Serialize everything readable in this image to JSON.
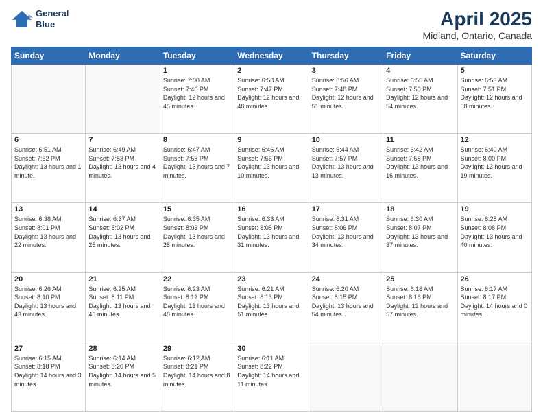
{
  "logo": {
    "line1": "General",
    "line2": "Blue"
  },
  "title": "April 2025",
  "subtitle": "Midland, Ontario, Canada",
  "header_days": [
    "Sunday",
    "Monday",
    "Tuesday",
    "Wednesday",
    "Thursday",
    "Friday",
    "Saturday"
  ],
  "weeks": [
    [
      {
        "num": "",
        "sunrise": "",
        "sunset": "",
        "daylight": "",
        "empty": true
      },
      {
        "num": "",
        "sunrise": "",
        "sunset": "",
        "daylight": "",
        "empty": true
      },
      {
        "num": "1",
        "sunrise": "Sunrise: 7:00 AM",
        "sunset": "Sunset: 7:46 PM",
        "daylight": "Daylight: 12 hours and 45 minutes."
      },
      {
        "num": "2",
        "sunrise": "Sunrise: 6:58 AM",
        "sunset": "Sunset: 7:47 PM",
        "daylight": "Daylight: 12 hours and 48 minutes."
      },
      {
        "num": "3",
        "sunrise": "Sunrise: 6:56 AM",
        "sunset": "Sunset: 7:48 PM",
        "daylight": "Daylight: 12 hours and 51 minutes."
      },
      {
        "num": "4",
        "sunrise": "Sunrise: 6:55 AM",
        "sunset": "Sunset: 7:50 PM",
        "daylight": "Daylight: 12 hours and 54 minutes."
      },
      {
        "num": "5",
        "sunrise": "Sunrise: 6:53 AM",
        "sunset": "Sunset: 7:51 PM",
        "daylight": "Daylight: 12 hours and 58 minutes."
      }
    ],
    [
      {
        "num": "6",
        "sunrise": "Sunrise: 6:51 AM",
        "sunset": "Sunset: 7:52 PM",
        "daylight": "Daylight: 13 hours and 1 minute."
      },
      {
        "num": "7",
        "sunrise": "Sunrise: 6:49 AM",
        "sunset": "Sunset: 7:53 PM",
        "daylight": "Daylight: 13 hours and 4 minutes."
      },
      {
        "num": "8",
        "sunrise": "Sunrise: 6:47 AM",
        "sunset": "Sunset: 7:55 PM",
        "daylight": "Daylight: 13 hours and 7 minutes."
      },
      {
        "num": "9",
        "sunrise": "Sunrise: 6:46 AM",
        "sunset": "Sunset: 7:56 PM",
        "daylight": "Daylight: 13 hours and 10 minutes."
      },
      {
        "num": "10",
        "sunrise": "Sunrise: 6:44 AM",
        "sunset": "Sunset: 7:57 PM",
        "daylight": "Daylight: 13 hours and 13 minutes."
      },
      {
        "num": "11",
        "sunrise": "Sunrise: 6:42 AM",
        "sunset": "Sunset: 7:58 PM",
        "daylight": "Daylight: 13 hours and 16 minutes."
      },
      {
        "num": "12",
        "sunrise": "Sunrise: 6:40 AM",
        "sunset": "Sunset: 8:00 PM",
        "daylight": "Daylight: 13 hours and 19 minutes."
      }
    ],
    [
      {
        "num": "13",
        "sunrise": "Sunrise: 6:38 AM",
        "sunset": "Sunset: 8:01 PM",
        "daylight": "Daylight: 13 hours and 22 minutes."
      },
      {
        "num": "14",
        "sunrise": "Sunrise: 6:37 AM",
        "sunset": "Sunset: 8:02 PM",
        "daylight": "Daylight: 13 hours and 25 minutes."
      },
      {
        "num": "15",
        "sunrise": "Sunrise: 6:35 AM",
        "sunset": "Sunset: 8:03 PM",
        "daylight": "Daylight: 13 hours and 28 minutes."
      },
      {
        "num": "16",
        "sunrise": "Sunrise: 6:33 AM",
        "sunset": "Sunset: 8:05 PM",
        "daylight": "Daylight: 13 hours and 31 minutes."
      },
      {
        "num": "17",
        "sunrise": "Sunrise: 6:31 AM",
        "sunset": "Sunset: 8:06 PM",
        "daylight": "Daylight: 13 hours and 34 minutes."
      },
      {
        "num": "18",
        "sunrise": "Sunrise: 6:30 AM",
        "sunset": "Sunset: 8:07 PM",
        "daylight": "Daylight: 13 hours and 37 minutes."
      },
      {
        "num": "19",
        "sunrise": "Sunrise: 6:28 AM",
        "sunset": "Sunset: 8:08 PM",
        "daylight": "Daylight: 13 hours and 40 minutes."
      }
    ],
    [
      {
        "num": "20",
        "sunrise": "Sunrise: 6:26 AM",
        "sunset": "Sunset: 8:10 PM",
        "daylight": "Daylight: 13 hours and 43 minutes."
      },
      {
        "num": "21",
        "sunrise": "Sunrise: 6:25 AM",
        "sunset": "Sunset: 8:11 PM",
        "daylight": "Daylight: 13 hours and 46 minutes."
      },
      {
        "num": "22",
        "sunrise": "Sunrise: 6:23 AM",
        "sunset": "Sunset: 8:12 PM",
        "daylight": "Daylight: 13 hours and 48 minutes."
      },
      {
        "num": "23",
        "sunrise": "Sunrise: 6:21 AM",
        "sunset": "Sunset: 8:13 PM",
        "daylight": "Daylight: 13 hours and 51 minutes."
      },
      {
        "num": "24",
        "sunrise": "Sunrise: 6:20 AM",
        "sunset": "Sunset: 8:15 PM",
        "daylight": "Daylight: 13 hours and 54 minutes."
      },
      {
        "num": "25",
        "sunrise": "Sunrise: 6:18 AM",
        "sunset": "Sunset: 8:16 PM",
        "daylight": "Daylight: 13 hours and 57 minutes."
      },
      {
        "num": "26",
        "sunrise": "Sunrise: 6:17 AM",
        "sunset": "Sunset: 8:17 PM",
        "daylight": "Daylight: 14 hours and 0 minutes."
      }
    ],
    [
      {
        "num": "27",
        "sunrise": "Sunrise: 6:15 AM",
        "sunset": "Sunset: 8:18 PM",
        "daylight": "Daylight: 14 hours and 3 minutes."
      },
      {
        "num": "28",
        "sunrise": "Sunrise: 6:14 AM",
        "sunset": "Sunset: 8:20 PM",
        "daylight": "Daylight: 14 hours and 5 minutes."
      },
      {
        "num": "29",
        "sunrise": "Sunrise: 6:12 AM",
        "sunset": "Sunset: 8:21 PM",
        "daylight": "Daylight: 14 hours and 8 minutes."
      },
      {
        "num": "30",
        "sunrise": "Sunrise: 6:11 AM",
        "sunset": "Sunset: 8:22 PM",
        "daylight": "Daylight: 14 hours and 11 minutes."
      },
      {
        "num": "",
        "sunrise": "",
        "sunset": "",
        "daylight": "",
        "empty": true
      },
      {
        "num": "",
        "sunrise": "",
        "sunset": "",
        "daylight": "",
        "empty": true
      },
      {
        "num": "",
        "sunrise": "",
        "sunset": "",
        "daylight": "",
        "empty": true
      }
    ]
  ]
}
